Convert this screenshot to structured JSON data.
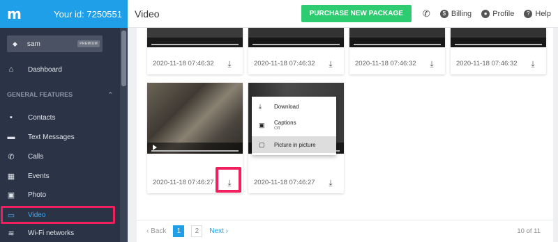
{
  "brand": {
    "logo": "m",
    "user_id": "Your id: 7250551"
  },
  "header": {
    "title": "Video",
    "purchase_label": "PURCHASE NEW PACKAGE",
    "billing": "Billing",
    "profile": "Profile",
    "help": "Help"
  },
  "sidebar": {
    "device_name": "sam",
    "device_badge": "PREMIUM",
    "dashboard": "Dashboard",
    "section": "GENERAL FEATURES",
    "items": [
      {
        "label": "Contacts",
        "icon": "contacts-icon"
      },
      {
        "label": "Text Messages",
        "icon": "messages-icon"
      },
      {
        "label": "Calls",
        "icon": "phone-icon"
      },
      {
        "label": "Events",
        "icon": "calendar-icon"
      },
      {
        "label": "Photo",
        "icon": "photo-icon"
      },
      {
        "label": "Video",
        "icon": "video-icon"
      },
      {
        "label": "Wi-Fi networks",
        "icon": "wifi-icon"
      }
    ]
  },
  "videos": [
    {
      "time": "2020-11-18 07:46:32"
    },
    {
      "time": "2020-11-18 07:46:32"
    },
    {
      "time": "2020-11-18 07:46:32"
    },
    {
      "time": "2020-11-18 07:46:32"
    },
    {
      "time": "2020-11-18 07:46:27"
    },
    {
      "time": "2020-11-18 07:46:27"
    }
  ],
  "context_menu": {
    "download": "Download",
    "captions": "Captions",
    "captions_state": "Off",
    "pip": "Picture in picture"
  },
  "pager": {
    "back": "Back",
    "page1": "1",
    "page2": "2",
    "next": "Next",
    "count": "10 of 11"
  },
  "colors": {
    "accent": "#1e9fe8",
    "purchase": "#2ecc71",
    "highlight": "#f0205f",
    "sidebar": "#2b3446"
  }
}
